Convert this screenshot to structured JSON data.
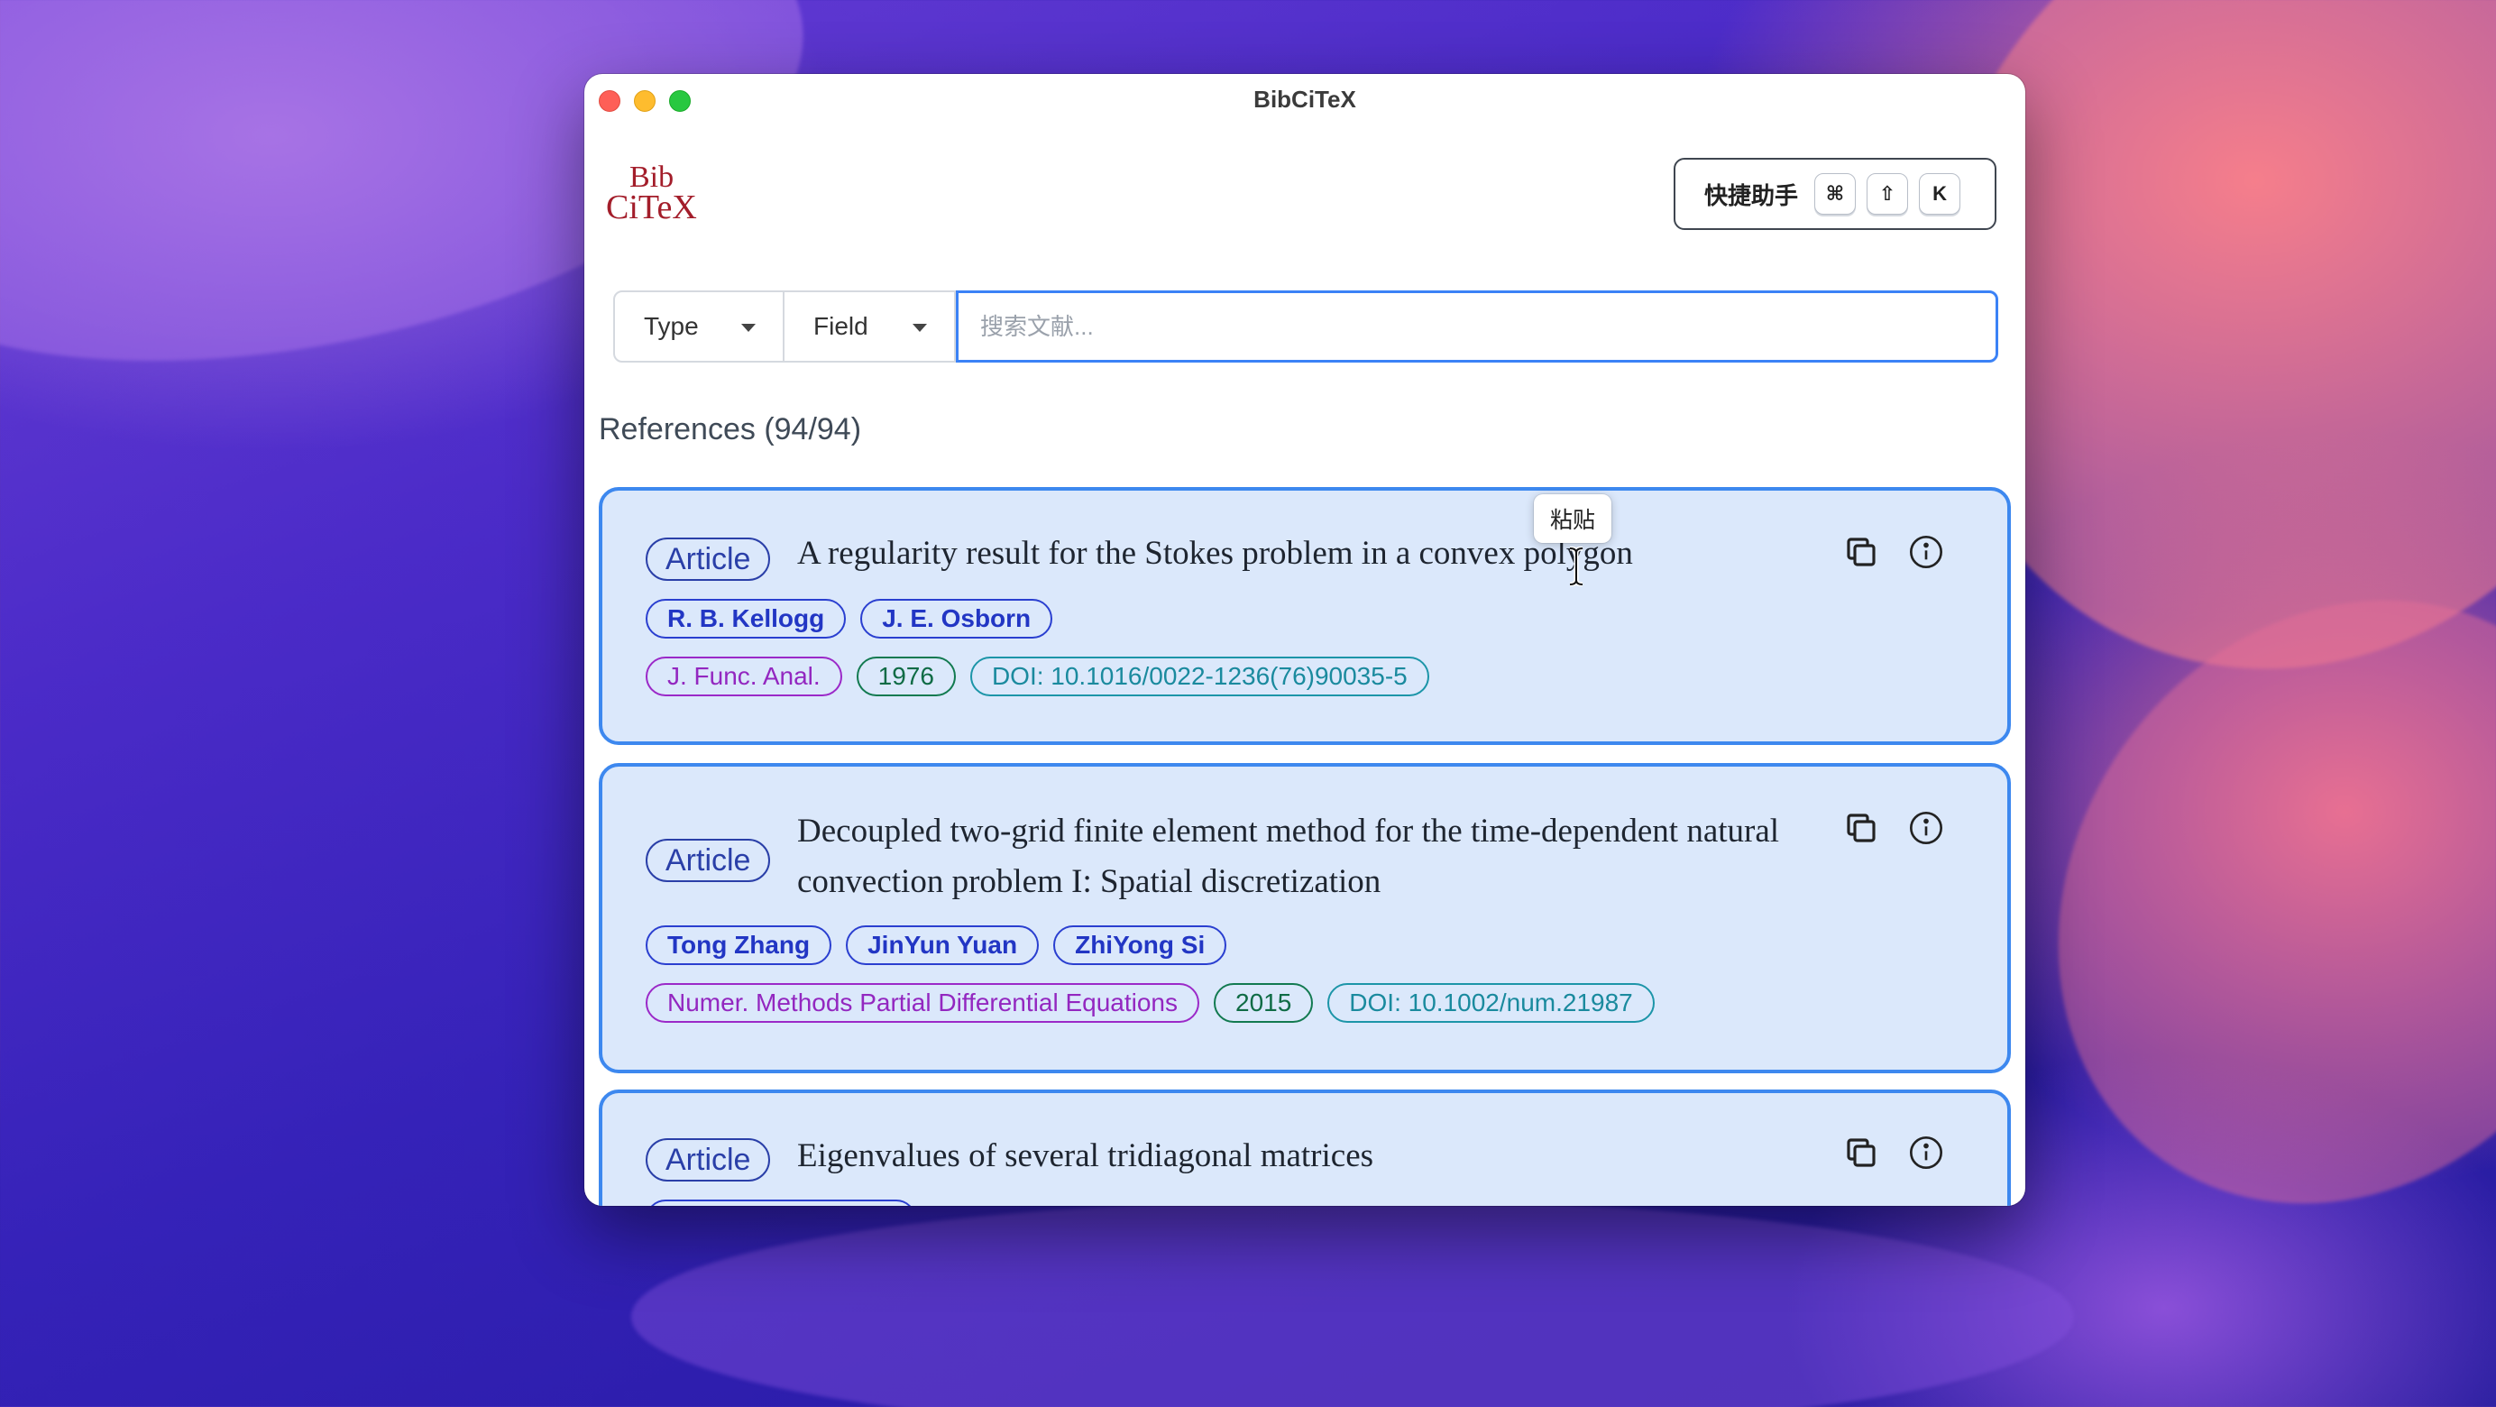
{
  "window": {
    "title": "BibCiTeX"
  },
  "logo": {
    "line1": "Bib",
    "line2": "CiTeX"
  },
  "shortcut_helper": {
    "label": "快捷助手",
    "keys": [
      "⌘",
      "⇧",
      "K"
    ]
  },
  "search": {
    "type_dropdown": "Type",
    "field_dropdown": "Field",
    "placeholder": "搜索文献..."
  },
  "references": {
    "heading": "References (94/94)"
  },
  "tooltip": {
    "text": "粘贴"
  },
  "items": [
    {
      "type": "Article",
      "title": "A regularity result for the Stokes problem in a convex polygon",
      "authors": [
        "R. B. Kellogg",
        "J. E. Osborn"
      ],
      "journal": "J. Func. Anal.",
      "year": "1976",
      "doi": "DOI: 10.1016/0022-1236(76)90035-5"
    },
    {
      "type": "Article",
      "title": "Decoupled two-grid finite element method for the time-dependent natural convection problem I: Spatial discretization",
      "authors": [
        "Tong Zhang",
        "JinYun Yuan",
        "ZhiYong Si"
      ],
      "journal": "Numer. Methods Partial Differential Equations",
      "year": "2015",
      "doi": "DOI: 10.1002/num.21987"
    },
    {
      "type": "Article",
      "title": "Eigenvalues of several tridiagonal matrices"
    }
  ],
  "colors": {
    "accent": "#3d88ef",
    "card_bg": "#dbe8fb",
    "author": "#2236c4",
    "journal": "#9327c0",
    "year": "#0f6b45",
    "doi": "#1a8a9e"
  }
}
